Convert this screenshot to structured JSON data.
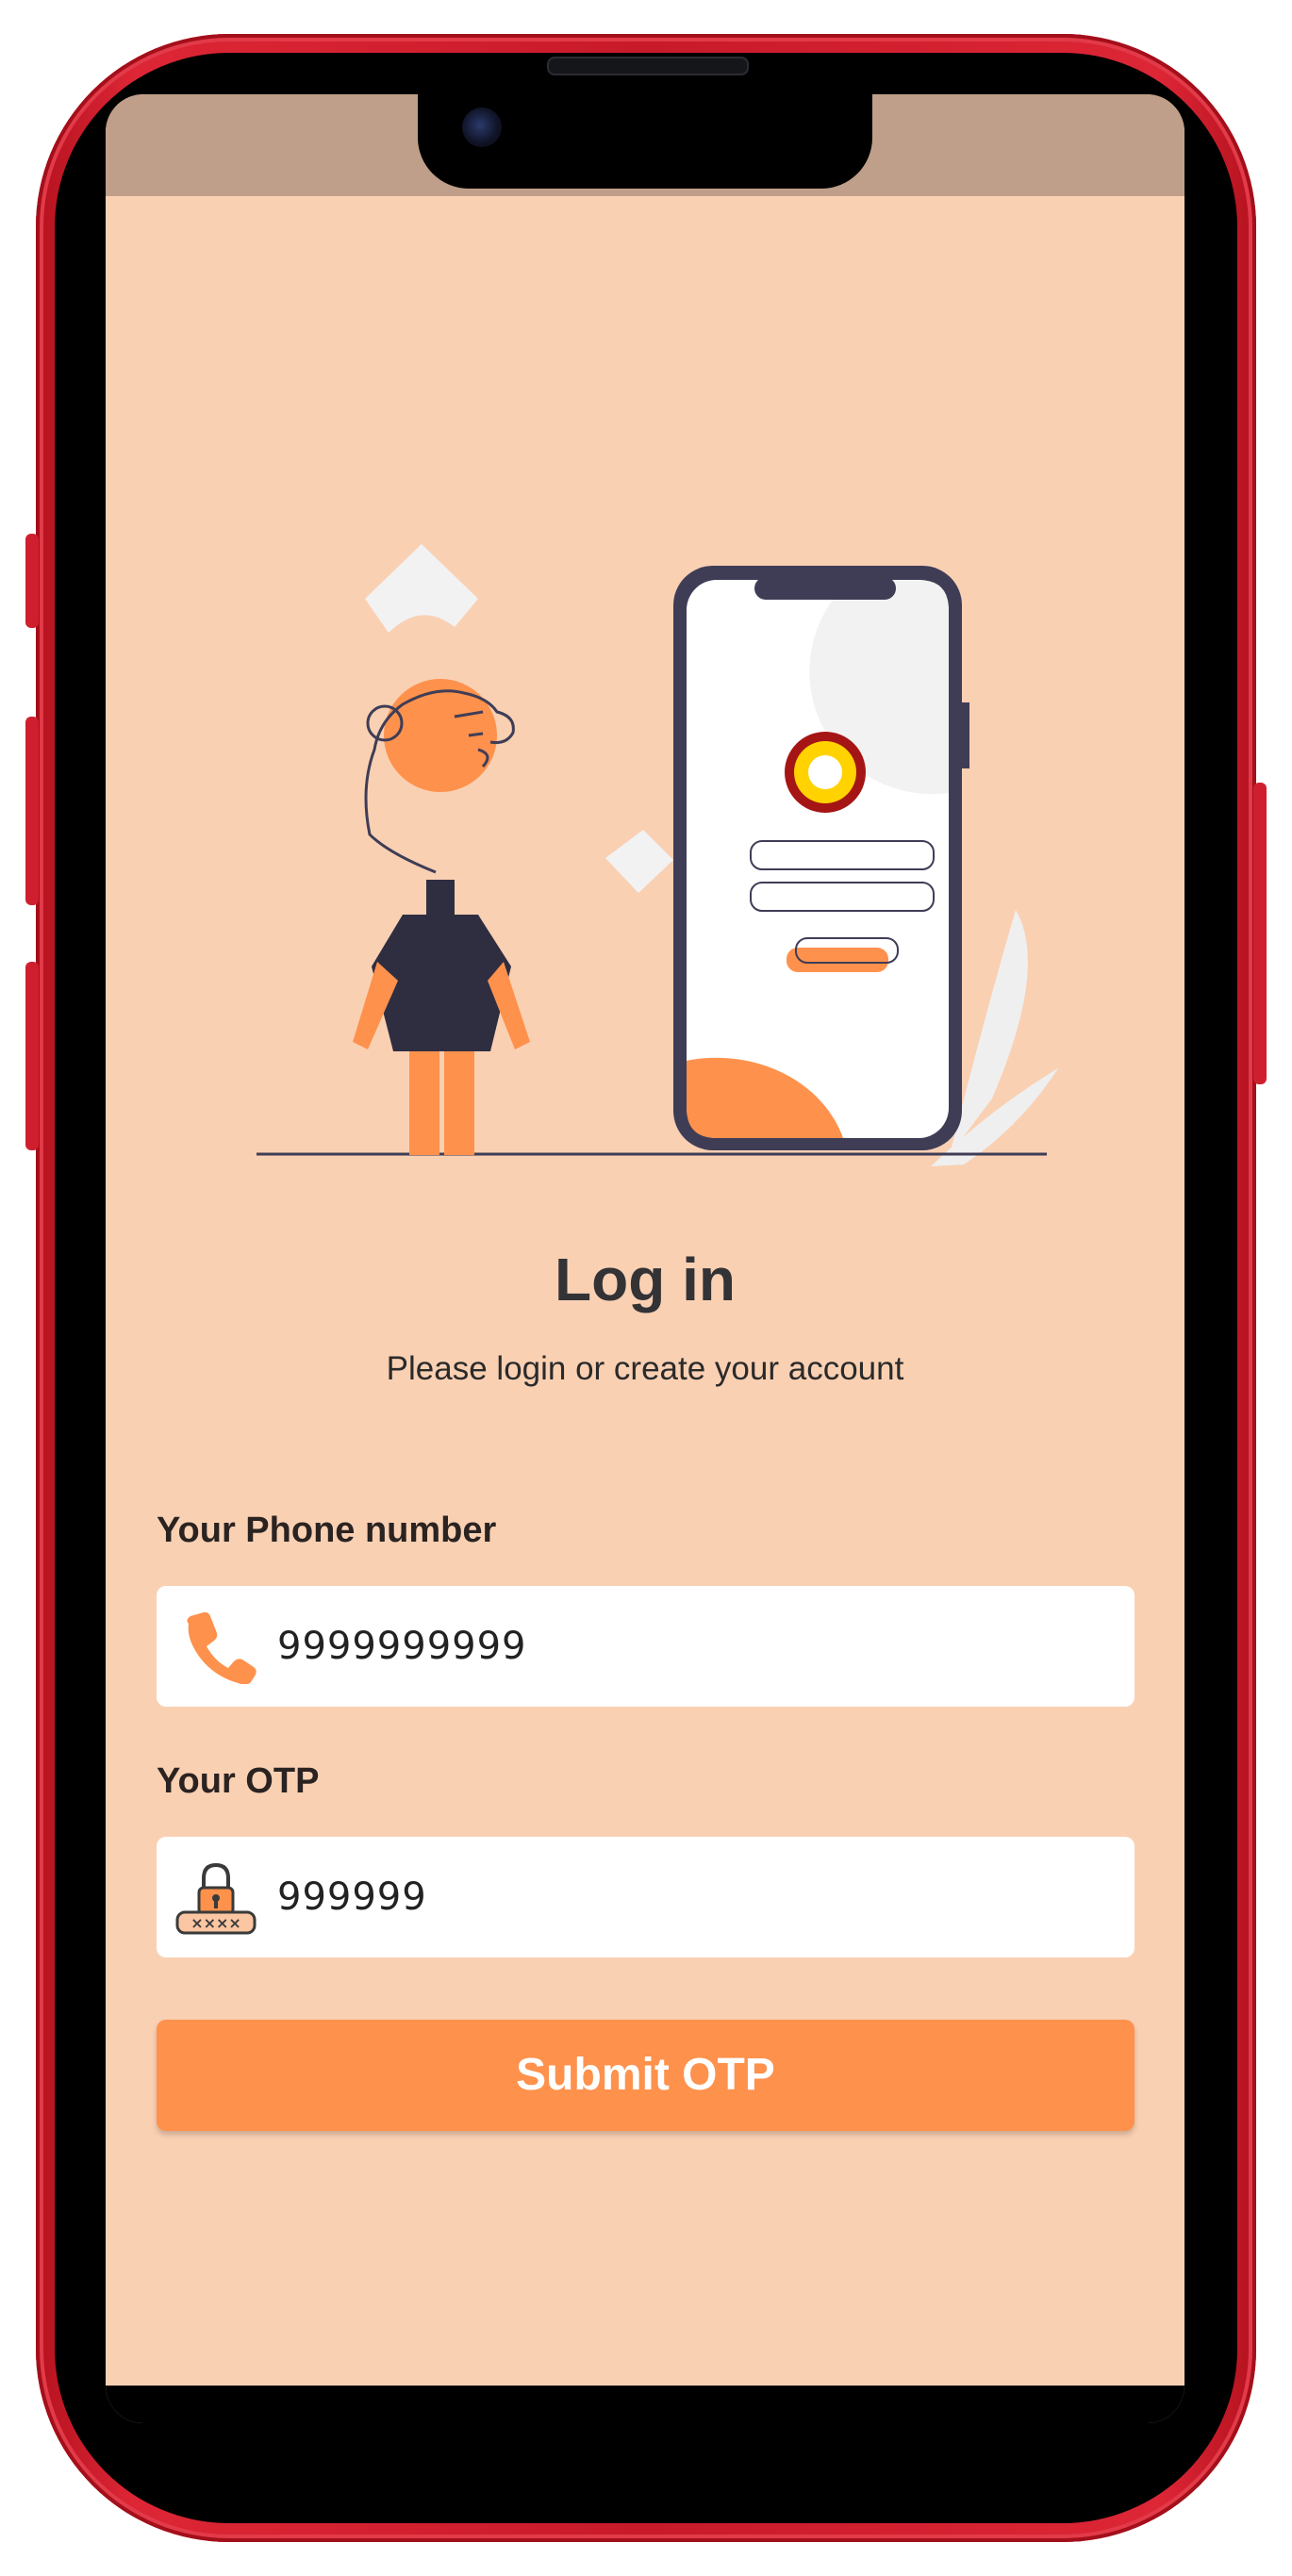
{
  "colors": {
    "device_frame": "#dd2636",
    "screen_background": "#fad0b3",
    "status_bar": "#bf9f89",
    "accent": "#fe914c",
    "title_text": "#333336"
  },
  "login": {
    "title": "Log in",
    "subtitle": "Please login or create your account"
  },
  "phone_field": {
    "label": "Your Phone number",
    "icon": "phone-icon",
    "value": "9999999999"
  },
  "otp_field": {
    "label": "Your OTP",
    "icon": "otp-lock-icon",
    "value": "999999"
  },
  "submit": {
    "label": "Submit OTP"
  },
  "illustration": {
    "icon": "mobile-login-illustration"
  }
}
